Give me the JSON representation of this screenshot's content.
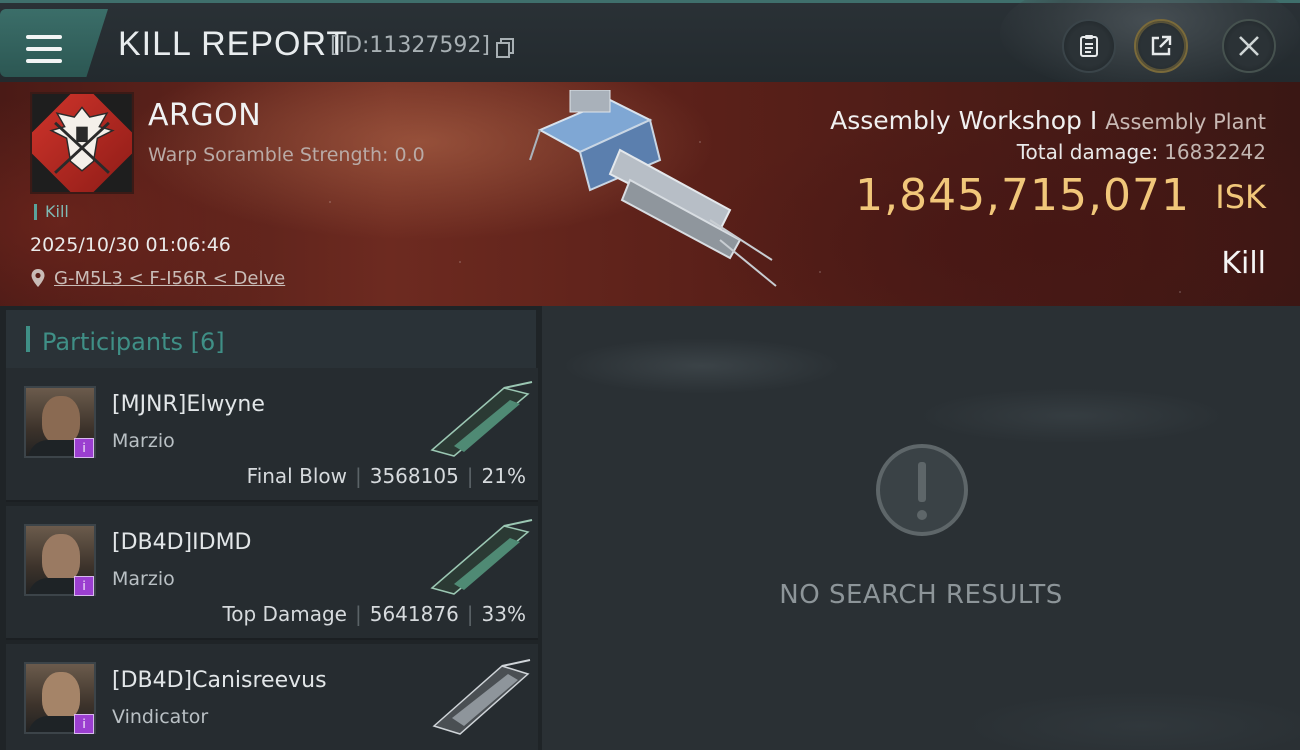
{
  "header": {
    "title": "KILL REPORT",
    "report_id": "[ID:11327592]"
  },
  "victim": {
    "corp_name": "ARGON",
    "warp_scramble": "Warp Soramble Strength: 0.0",
    "kill_tag": "Kill",
    "datetime": "2025/10/30 01:06:46",
    "location": "G-M5L3 < F-I56R < Delve",
    "structure_name": "Assembly Workshop I",
    "structure_type": "Assembly Plant",
    "total_damage_label": "Total damage:",
    "total_damage_value": "16832242",
    "isk_value": "1,845,715,071",
    "isk_unit": "ISK",
    "result_type": "Kill"
  },
  "participants": {
    "label": "Participants",
    "count": "[6]",
    "items": [
      {
        "name": "[MJNR]Elwyne",
        "ship": "Marzio",
        "tag": "Final Blow",
        "damage": "3568105",
        "percent": "21%"
      },
      {
        "name": "[DB4D]IDMD",
        "ship": "Marzio",
        "tag": "Top Damage",
        "damage": "5641876",
        "percent": "33%"
      },
      {
        "name": "[DB4D]Canisreevus",
        "ship": "Vindicator",
        "tag": "",
        "damage": "",
        "percent": ""
      }
    ]
  },
  "right": {
    "no_results": "NO SEARCH RESULTS"
  },
  "colors": {
    "accent": "#3f8f86",
    "isk": "#f1c77a",
    "badge": "#9b3fd0"
  }
}
